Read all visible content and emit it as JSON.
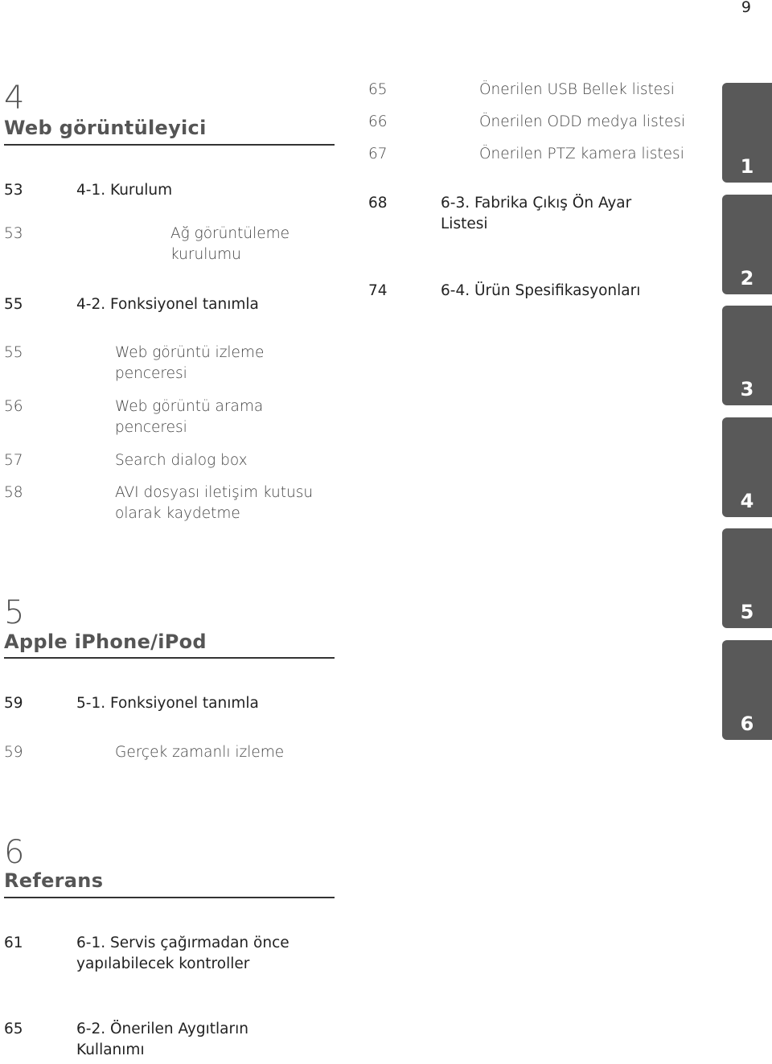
{
  "page_number": "9",
  "chapters": [
    {
      "number": "4",
      "title": "Web görüntüleyici",
      "entries": [
        {
          "page": "53",
          "text": "4-1. Kurulum",
          "level": 1
        },
        {
          "page": "53",
          "text": "Ağ görüntüleme kurulumu",
          "level": 2
        },
        {
          "page": "55",
          "text": "4-2. Fonksiyonel tanımla",
          "level": 1
        },
        {
          "page": "55",
          "text": "Web görüntü izleme penceresi",
          "level": 2
        },
        {
          "page": "56",
          "text": "Web görüntü arama penceresi",
          "level": 2
        },
        {
          "page": "57",
          "text": "Search dialog box",
          "level": 2
        },
        {
          "page": "58",
          "text": "AVI dosyası iletişim kutusu olarak kaydetme",
          "level": 2
        }
      ]
    },
    {
      "number": "5",
      "title": "Apple iPhone/iPod",
      "entries": [
        {
          "page": "59",
          "text": "5-1. Fonksiyonel tanımla",
          "level": 1
        },
        {
          "page": "59",
          "text": "Gerçek zamanlı izleme",
          "level": 2
        }
      ]
    },
    {
      "number": "6",
      "title": "Referans",
      "entries": [
        {
          "page": "61",
          "text": "6-1. Servis çağırmadan önce yapılabilecek kontroller",
          "level": 1
        },
        {
          "page": "65",
          "text": "6-2. Önerilen Aygıtların Kullanımı",
          "level": 1
        },
        {
          "page": "65",
          "text": "Önerilen USB Bellek listesi",
          "level": 2
        },
        {
          "page": "66",
          "text": "Önerilen ODD medya listesi",
          "level": 2
        },
        {
          "page": "67",
          "text": "Önerilen PTZ kamera listesi",
          "level": 2
        },
        {
          "page": "68",
          "text": "6-3. Fabrika Çıkış Ön Ayar Listesi",
          "level": 1
        },
        {
          "page": "74",
          "text": "6-4. Ürün Spesifikasyonları",
          "level": 1
        }
      ]
    }
  ],
  "side_tabs": [
    "1",
    "2",
    "3",
    "4",
    "5",
    "6"
  ],
  "colors": {
    "tab": "#595959",
    "heading": "#555555",
    "rule": "#333333"
  }
}
